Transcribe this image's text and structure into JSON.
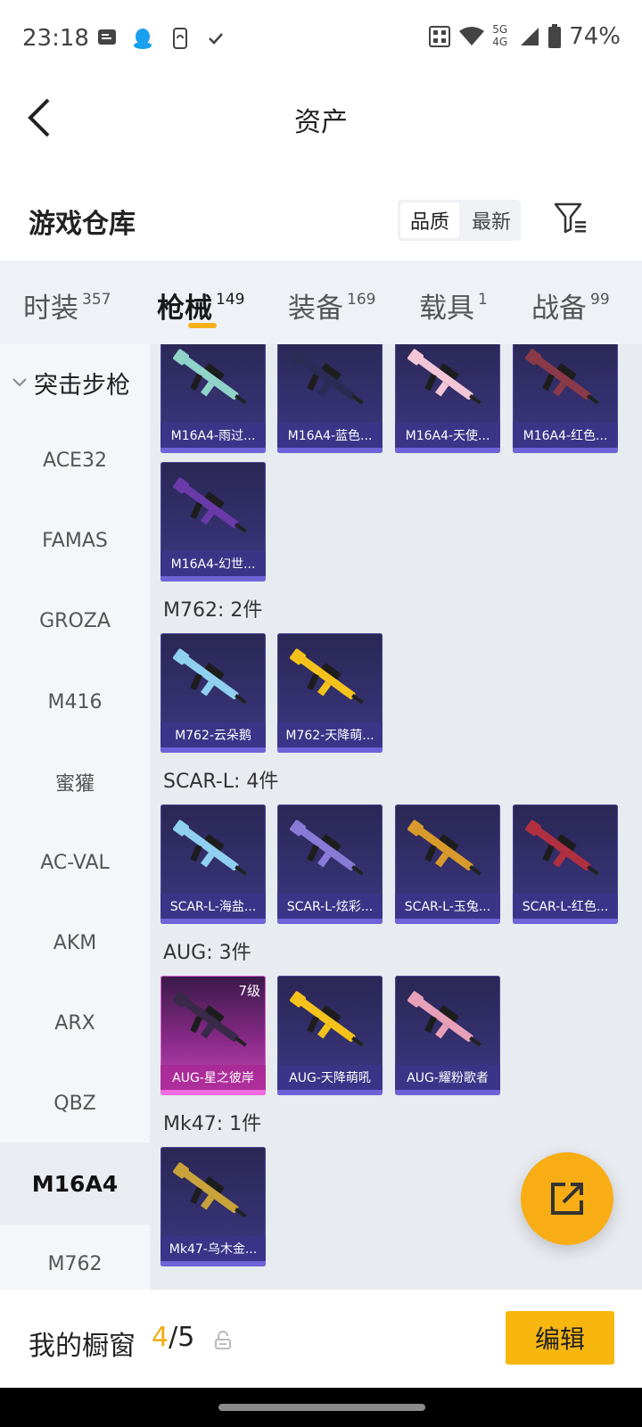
{
  "status": {
    "time": "23:18",
    "battery": "74%",
    "network_top": "5G",
    "network_bottom": "4G",
    "icons": [
      "message-icon",
      "qq-penguin-icon",
      "phone-sync-icon",
      "check-icon",
      "nfc-icon",
      "wifi-icon",
      "signal-icon",
      "battery-icon"
    ]
  },
  "header": {
    "title": "资产",
    "back_icon": "chevron-left-icon"
  },
  "section": {
    "title": "游戏仓库",
    "sort_options": [
      "品质",
      "最新"
    ],
    "sort_selected": "品质",
    "filter_icon": "filter-icon"
  },
  "tabs": [
    {
      "label": "时装",
      "count": "357"
    },
    {
      "label": "枪械",
      "count": "149",
      "active": true
    },
    {
      "label": "装备",
      "count": "169"
    },
    {
      "label": "载具",
      "count": "1"
    },
    {
      "label": "战备",
      "count": "99"
    }
  ],
  "sidebar": {
    "category": "突击步枪",
    "items": [
      "ACE32",
      "FAMAS",
      "GROZA",
      "M416",
      "蜜獾",
      "AC-VAL",
      "AKM",
      "ARX",
      "QBZ",
      "M16A4",
      "M762"
    ],
    "selected": "M16A4"
  },
  "groups": [
    {
      "title": "",
      "items": [
        {
          "name": "M16A4-雨过...",
          "color": "#8fd3c9"
        },
        {
          "name": "M16A4-蓝色...",
          "color": "#2b2b55"
        },
        {
          "name": "M16A4-天使...",
          "color": "#f2c6d6"
        },
        {
          "name": "M16A4-红色...",
          "color": "#8a3a48"
        },
        {
          "name": "M16A4-幻世...",
          "color": "#6a3aa8"
        }
      ]
    },
    {
      "title": "M762: 2件",
      "items": [
        {
          "name": "M762-云朵鹅",
          "color": "#8fd0f0"
        },
        {
          "name": "M762-天降萌...",
          "color": "#f4c21a"
        }
      ]
    },
    {
      "title": "SCAR-L: 4件",
      "items": [
        {
          "name": "SCAR-L-海盐...",
          "color": "#8fd0f0"
        },
        {
          "name": "SCAR-L-炫彩...",
          "color": "#8a7ad8"
        },
        {
          "name": "SCAR-L-玉兔...",
          "color": "#d89a2a"
        },
        {
          "name": "SCAR-L-红色...",
          "color": "#b03040"
        }
      ]
    },
    {
      "title": "AUG: 3件",
      "items": [
        {
          "name": "AUG-星之彼岸",
          "color": "#3a2a4a",
          "level": "7级",
          "quality": "pink"
        },
        {
          "name": "AUG-天降萌吼",
          "color": "#f4c21a"
        },
        {
          "name": "AUG-耀粉歌者",
          "color": "#e8a0b8"
        }
      ]
    },
    {
      "title": "Mk47: 1件",
      "items": [
        {
          "name": "Mk47-乌木金...",
          "color": "#c9a23a"
        }
      ]
    }
  ],
  "fab_icon": "share-external-icon",
  "showcase": {
    "label": "我的橱窗",
    "current": "4",
    "separator": "/",
    "max": "5",
    "lock_icon": "lock-icon",
    "edit_label": "编辑"
  }
}
